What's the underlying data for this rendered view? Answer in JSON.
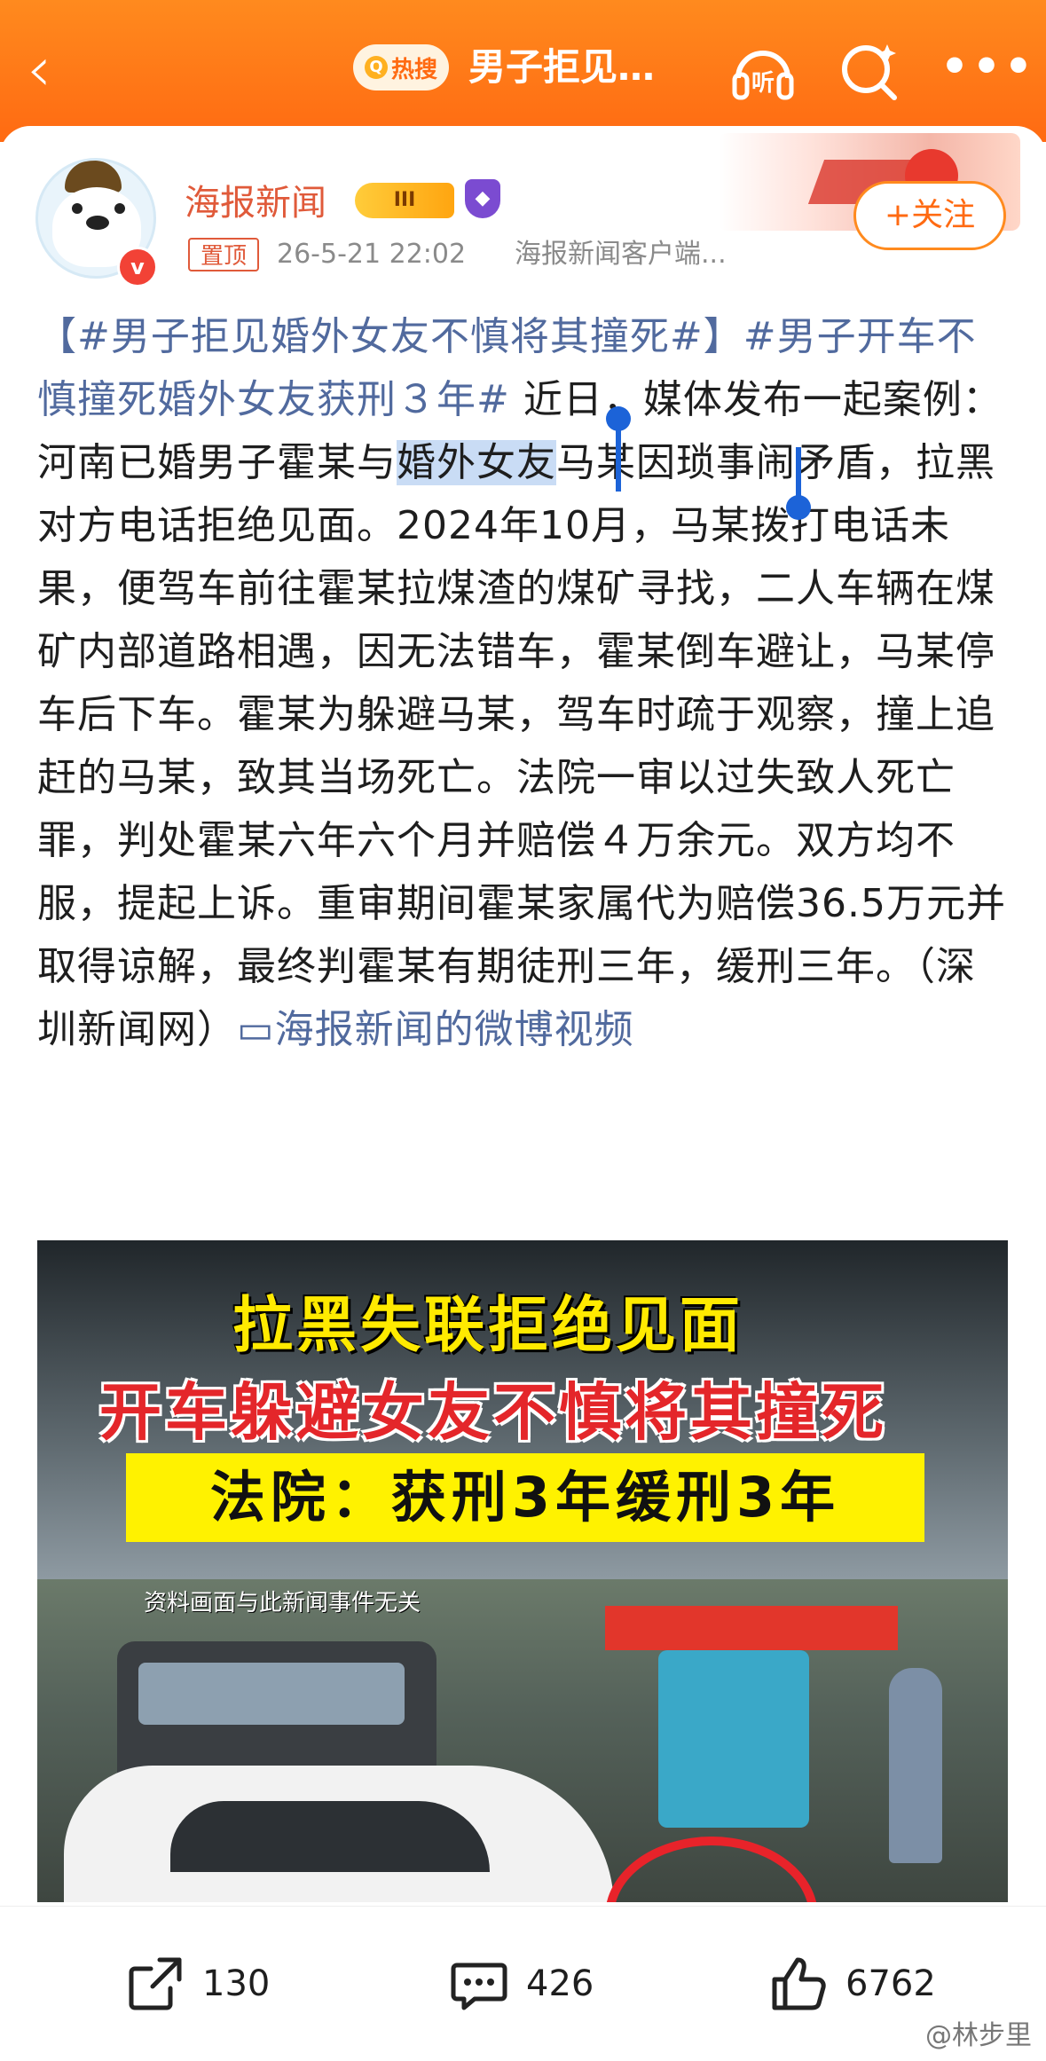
{
  "header": {
    "back_icon": "chevron-left-icon",
    "hot_badge": "热搜",
    "title": "男子拒见…",
    "listen_label": "听"
  },
  "post": {
    "author": "海报新闻",
    "level_badge": "III",
    "pin_label": "置顶",
    "time": "26-5-21 22:02",
    "source": "海报新闻客户端...",
    "follow_label": "+关注",
    "text": {
      "tag1": "【#男子拒见婚外女友不慎将其撞死#】",
      "tag2": "#男子开车不慎撞死婚外女友获刑３年#",
      "p1": " 近日，媒体发布一起案例：河南已婚男子霍某与",
      "highlight": "婚外女友",
      "p2": "马某因琐事闹矛盾，拉黑对方电话拒绝见面。2024年10月，马某拨打电话未果，便驾车前往霍某拉煤渣的煤矿寻找，二人车辆在煤矿内部道路相遇，因无法错车，霍某倒车避让，马某停车后下车。霍某为躲避马某，驾车时疏于观察，撞上追赶的马某，致其当场死亡。法院一审以过失致人死亡罪，判处霍某六年六个月并赔偿４万余元。双方均不服，提起上诉。重审期间霍某家属代为赔偿36.5万元并取得谅解，最终判霍某有期徒刑三年，缓刑三年。（深圳新闻网）",
      "video_link": "海报新闻的微博视频"
    }
  },
  "video": {
    "line1": "拉黑失联拒绝见面",
    "line2": "开车躲避女友不慎将其撞死",
    "line3": "法院：获刑3年缓刑3年",
    "note": "资料画面与此新闻事件无关"
  },
  "actions": {
    "share_count": "130",
    "comment_count": "426",
    "like_count": "6762"
  },
  "watermark": "@林步里",
  "colors": {
    "header": "#ff6a12",
    "link": "#516a9e",
    "accent": "#e05a3a"
  }
}
